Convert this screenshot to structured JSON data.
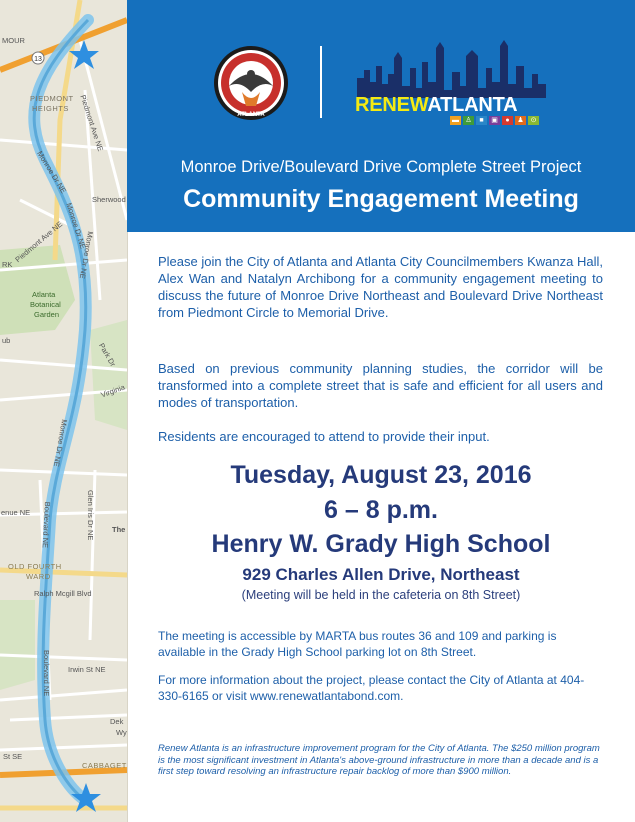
{
  "map": {
    "labels": [
      "MOUR",
      "PIEDMONT",
      "HEIGHTS",
      "Piedmont Ave NE",
      "Monroe Dr NE",
      "Monroe Dr NE",
      "Sherwood",
      "Piedmont Ave NE",
      "Monroe Dr NE",
      "Atlanta",
      "Botanical",
      "Garden",
      "RK",
      "ub",
      "Park Dr",
      "Virginia Av",
      "Monroe Dr NE",
      "enue NE",
      "Boulevard NE",
      "Glen Iris Dr NE",
      "The",
      "OLD FOURTH",
      "WARD",
      "Ralph Mcgill Blvd",
      "Irwin St NE",
      "Boulevard NE",
      "Dek",
      "Wy",
      "St SE",
      "CABBAGET"
    ],
    "route_markers": [
      "13",
      "13"
    ],
    "icons": [
      "start-star-icon",
      "end-star-icon"
    ]
  },
  "header": {
    "seal_text": "ATLANTA",
    "logo_renew": "RENEW",
    "logo_atlanta": "ATLANTA",
    "mode_icons": [
      "road-icon",
      "pedestrian-icon",
      "car-icon",
      "bus-icon",
      "signal-icon",
      "person-icon",
      "bicycle-icon"
    ],
    "project_name": "Monroe Drive/Boulevard Drive Complete Street Project",
    "meeting_title": "Community Engagement Meeting",
    "colors": {
      "header_blue": "#1570bd",
      "logo_yellow": "#f5ea12",
      "skyline": "#1a2f68"
    }
  },
  "body": {
    "paragraph_1": "Please join the City of Atlanta and Atlanta City Councilmembers Kwanza Hall, Alex Wan and Natalyn Archibong for a community engagement meeting to discuss the future of Monroe Drive Northeast and Boulevard Drive Northeast from Piedmont Circle to Memorial Drive.",
    "paragraph_2": "Based on previous community planning studies, the corridor will be transformed into a complete street that is safe and efficient for all users and modes of transportation.",
    "paragraph_3": "Residents are encouraged to attend to provide their input.",
    "date": "Tuesday, August 23, 2016",
    "time": "6 – 8 p.m.",
    "venue": "Henry W. Grady High School",
    "address": "929 Charles Allen Drive, Northeast",
    "location_note": "(Meeting will be held in the cafeteria on 8th Street)",
    "transit": "The meeting is accessible by MARTA bus routes 36 and 109 and parking is available in the Grady High School parking lot on 8th Street.",
    "contact": "For more information about the project, please contact the City of Atlanta at 404-330-6165 or visit www.renewatlantabond.com.",
    "footer_note": "Renew Atlanta is an infrastructure improvement program for the City of Atlanta. The $250 million program is the most significant investment in Atlanta's above-ground infrastructure in more than a decade and is a first step toward resolving an infrastructure repair backlog of more than $900 million.",
    "colors": {
      "text_blue": "#1d5fa9",
      "event_navy": "#253a7a"
    }
  }
}
